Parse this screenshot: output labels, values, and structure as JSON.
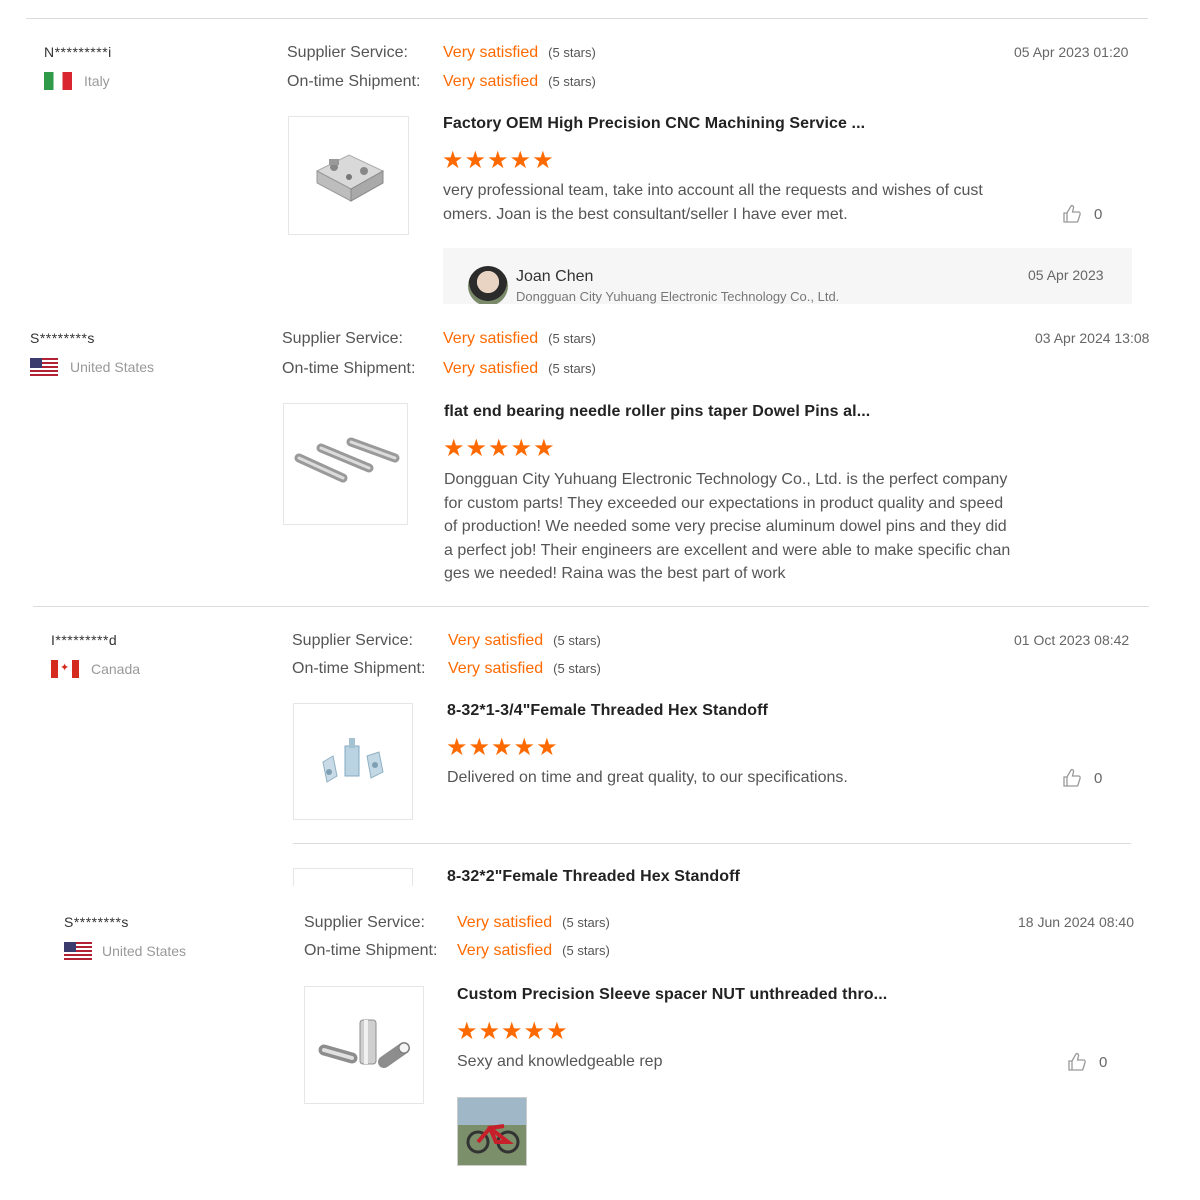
{
  "reviews": [
    {
      "user": "N*********i",
      "country": "Italy",
      "flag": "italy-flag-icon",
      "supplier_label": "Supplier Service:",
      "supplier_value": "Very satisfied",
      "supplier_stars": "(5 stars)",
      "shipment_label": "On-time Shipment:",
      "shipment_value": "Very satisfied",
      "shipment_stars": "(5 stars)",
      "date": "05 Apr 2023 01:20",
      "product": "Factory OEM High Precision CNC Machining Service ...",
      "stars": "★★★★★",
      "text": "very professional team, take into account all the requests and wishes of customers. Joan is the best consultant/seller I have ever met.",
      "likes": "0",
      "reply": {
        "name": "Joan Chen",
        "company": "Dongguan City Yuhuang Electronic Technology Co., Ltd.",
        "date": "05 Apr 2023"
      }
    },
    {
      "user": "S********s",
      "country": "United States",
      "flag": "usa-flag-icon",
      "supplier_label": "Supplier Service:",
      "supplier_value": "Very satisfied",
      "supplier_stars": "(5 stars)",
      "shipment_label": "On-time Shipment:",
      "shipment_value": "Very satisfied",
      "shipment_stars": "(5 stars)",
      "date": "03 Apr 2024 13:08",
      "product": "flat end bearing needle roller pins taper Dowel Pins al...",
      "stars": "★★★★★",
      "text": "Dongguan City Yuhuang Electronic Technology Co., Ltd. is the perfect company for custom parts! They exceeded our expectations in product quality and speed of production!  We needed some very precise aluminum dowel pins and they did a perfect job! Their engineers are excellent and were able to make specific changes we needed! Raina was the best part of work"
    },
    {
      "user": "I*********d",
      "country": "Canada",
      "flag": "canada-flag-icon",
      "supplier_label": "Supplier Service:",
      "supplier_value": "Very satisfied",
      "supplier_stars": "(5 stars)",
      "shipment_label": "On-time Shipment:",
      "shipment_value": "Very satisfied",
      "shipment_stars": "(5 stars)",
      "date": "01 Oct 2023 08:42",
      "product": "8-32*1-3/4\"Female Threaded Hex Standoff",
      "stars": "★★★★★",
      "text": "Delivered on time and great quality, to our specifications.",
      "likes": "0",
      "product2": "8-32*2\"Female Threaded Hex Standoff"
    },
    {
      "user": "S********s",
      "country": "United States",
      "flag": "usa-flag-icon",
      "supplier_label": "Supplier Service:",
      "supplier_value": "Very satisfied",
      "supplier_stars": "(5 stars)",
      "shipment_label": "On-time Shipment:",
      "shipment_value": "Very satisfied",
      "shipment_stars": "(5 stars)",
      "date": "18 Jun 2024 08:40",
      "product": "Custom Precision Sleeve spacer NUT unthreaded thro...",
      "stars": "★★★★★",
      "text": "Sexy and knowledgeable rep",
      "likes": "0"
    }
  ]
}
